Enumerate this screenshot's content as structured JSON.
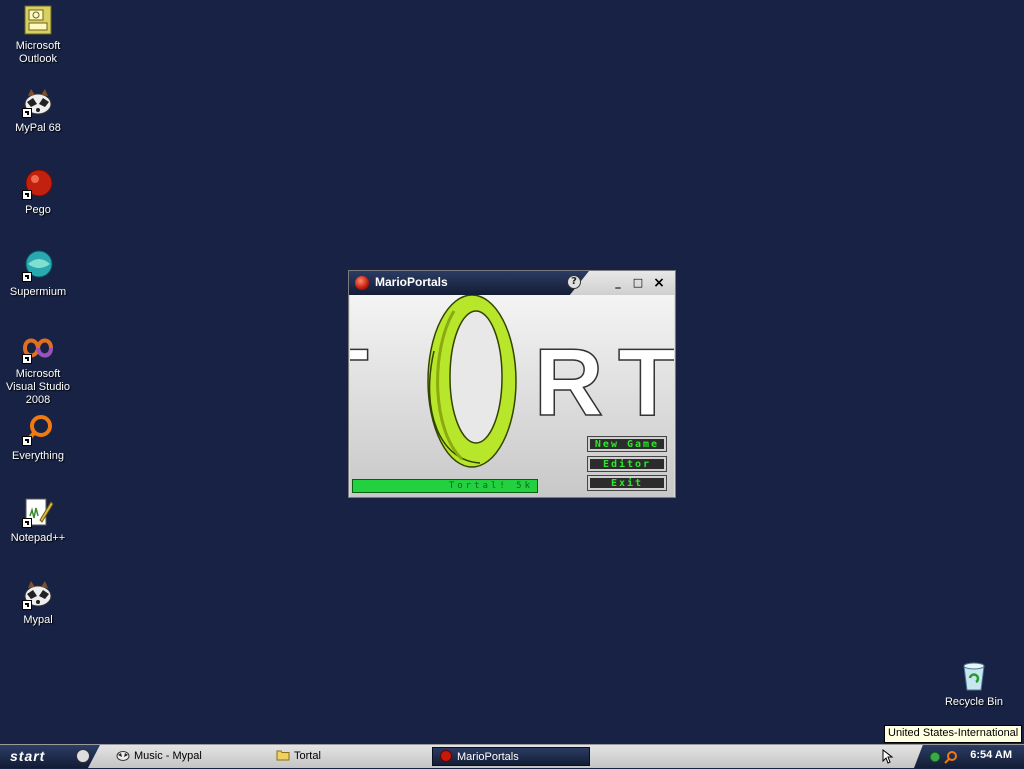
{
  "desktop": {
    "icons": [
      {
        "label": "Microsoft Outlook",
        "icon": "outlook-icon"
      },
      {
        "label": "MyPal 68",
        "icon": "raccoon-icon"
      },
      {
        "label": "Pego",
        "icon": "pego-icon"
      },
      {
        "label": "Supermium",
        "icon": "supermium-icon"
      },
      {
        "label": "Microsoft Visual Studio 2008",
        "icon": "visual-studio-icon"
      },
      {
        "label": "Everything",
        "icon": "everything-icon"
      },
      {
        "label": "Notepad++",
        "icon": "notepadpp-icon"
      },
      {
        "label": "Mypal",
        "icon": "raccoon-icon"
      },
      {
        "label": "Recycle Bin",
        "icon": "recycle-bin-icon"
      }
    ]
  },
  "window": {
    "title": "MarioPortals",
    "help_label": "?",
    "minimize_label": "_",
    "maximize_label": "□",
    "close_label": "×",
    "logo_letters": [
      "T",
      "R",
      "T"
    ],
    "menu": {
      "new_game": "New Game",
      "editor": "Editor",
      "exit": "Exit"
    },
    "progress_text": "Tortal! 5k",
    "colors": {
      "portal": "#b8e62a",
      "menu_text": "#2ce82c",
      "progress": "#22d040"
    }
  },
  "taskbar": {
    "start_label": "start",
    "tasks": [
      {
        "label": "Music - Mypal",
        "icon": "raccoon-icon"
      },
      {
        "label": "Tortal",
        "icon": "folder-icon"
      },
      {
        "label": "MarioPortals",
        "icon": "marioportals-icon"
      }
    ],
    "clock": "6:54 AM",
    "tooltip": "United States-International"
  }
}
